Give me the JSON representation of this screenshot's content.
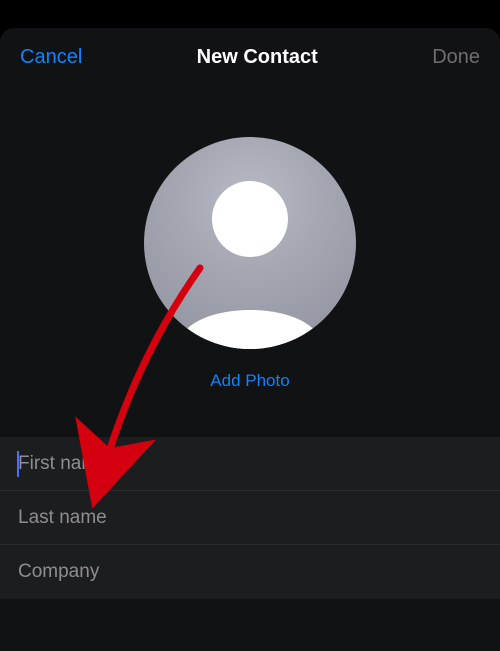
{
  "nav": {
    "cancel": "Cancel",
    "title": "New Contact",
    "done": "Done"
  },
  "avatar": {
    "add_photo": "Add Photo"
  },
  "fields": {
    "first_name_placeholder": "First name",
    "first_name_value": "",
    "last_name_placeholder": "Last name",
    "last_name_value": "",
    "company_placeholder": "Company",
    "company_value": ""
  }
}
